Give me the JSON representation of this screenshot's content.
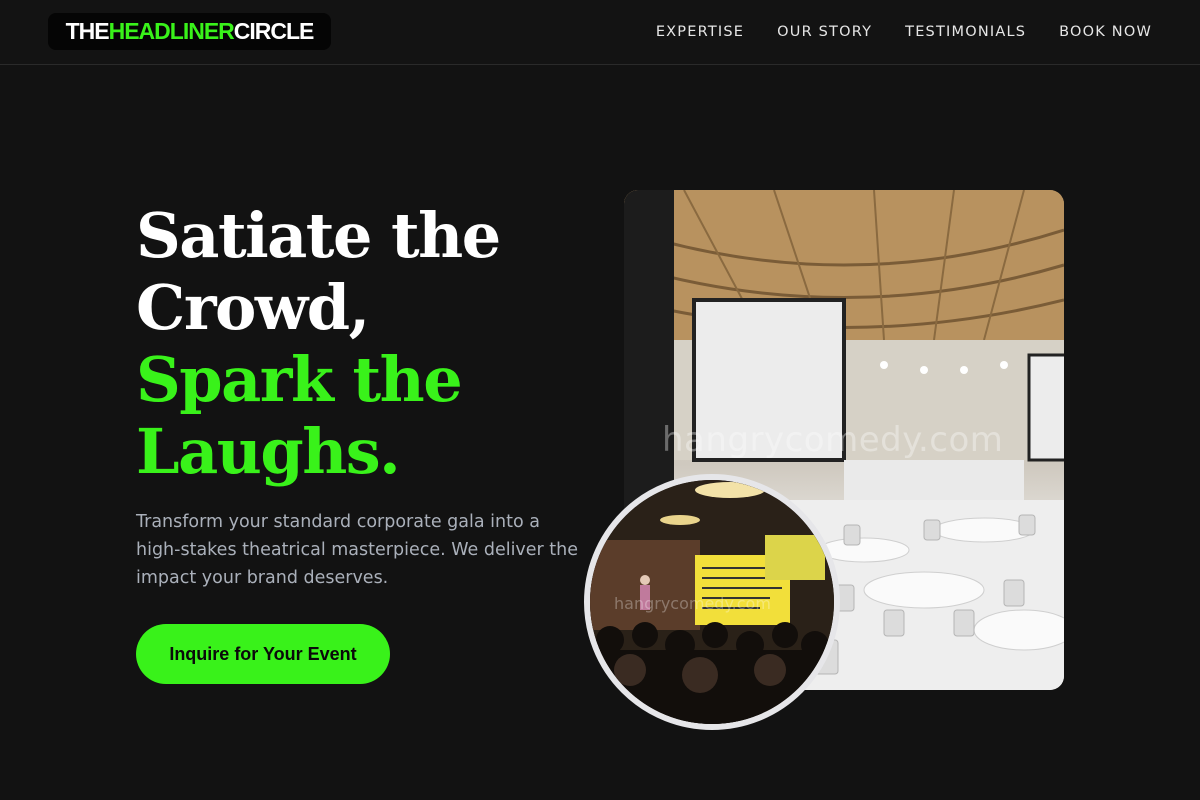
{
  "header": {
    "logo": {
      "part1": "THE ",
      "part2": "HEADLINER",
      "part3": " CIRCLE"
    },
    "nav": [
      {
        "label": "EXPERTISE"
      },
      {
        "label": "OUR STORY"
      },
      {
        "label": "TESTIMONIALS"
      },
      {
        "label": "BOOK NOW"
      }
    ]
  },
  "hero": {
    "title_line1": "Satiate the",
    "title_line2": "Crowd,",
    "title_line3": "Spark the",
    "title_line4": "Laughs.",
    "description": "Transform your standard corporate gala into a high-stakes theatrical masterpiece. We deliver the impact your brand deserves.",
    "cta_label": "Inquire for Your Event"
  },
  "images": {
    "main_photo_alt": "conference-hall-photo",
    "main_watermark": "hangrycomedy.com",
    "inset_photo_alt": "comedy-show-audience-photo",
    "inset_watermark": "hangrycomedy.com"
  },
  "colors": {
    "accent": "#39f21a",
    "background": "#121212",
    "text": "#ffffff",
    "muted": "#aab0ba"
  }
}
